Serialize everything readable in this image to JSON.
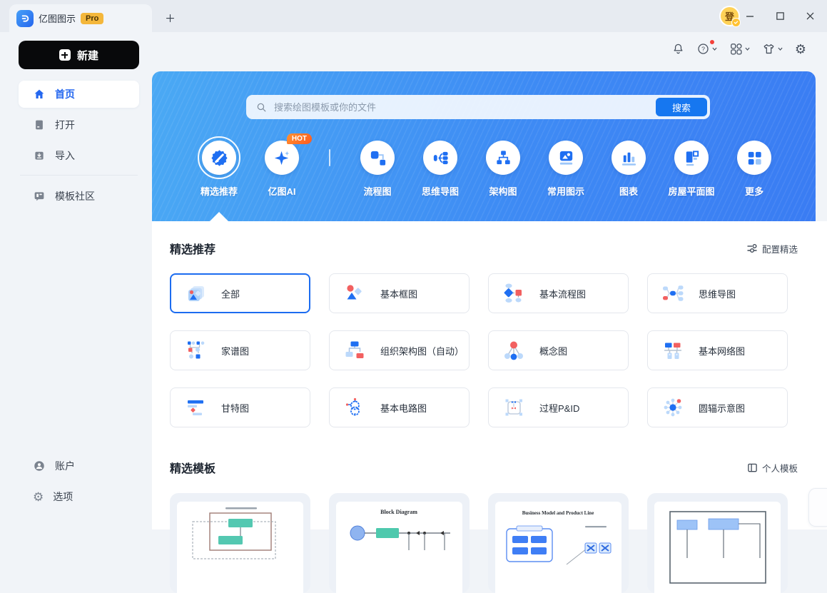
{
  "titlebar": {
    "app_name": "亿图图示",
    "pro_badge": "Pro",
    "avatar_text": "登"
  },
  "icons": {
    "gear": "⚙",
    "question": "?"
  },
  "sidebar": {
    "new_button": "新建",
    "items": [
      {
        "label": "首页",
        "icon": "home",
        "active": true
      },
      {
        "label": "打开",
        "icon": "open-document"
      },
      {
        "label": "导入",
        "icon": "import"
      },
      {
        "label": "模板社区",
        "icon": "template-community"
      }
    ],
    "footer": [
      {
        "label": "账户",
        "icon": "account"
      },
      {
        "label": "选项",
        "icon": "options-gear"
      }
    ]
  },
  "banner": {
    "search_placeholder": "搜索绘图模板或你的文件",
    "search_button": "搜索",
    "hot_badge": "HOT",
    "categories": [
      {
        "label": "精选推荐",
        "selected": true
      },
      {
        "label": "亿图AI",
        "hot": true
      },
      {
        "label": "流程图"
      },
      {
        "label": "思维导图"
      },
      {
        "label": "架构图"
      },
      {
        "label": "常用图示"
      },
      {
        "label": "图表"
      },
      {
        "label": "房屋平面图"
      },
      {
        "label": "更多"
      }
    ]
  },
  "featured": {
    "title": "精选推荐",
    "action": "配置精选",
    "cards": [
      {
        "label": "全部",
        "selected": true
      },
      {
        "label": "基本框图"
      },
      {
        "label": "基本流程图"
      },
      {
        "label": "思维导图"
      },
      {
        "label": "家谱图"
      },
      {
        "label": "组织架构图（自动）"
      },
      {
        "label": "概念图"
      },
      {
        "label": "基本网络图"
      },
      {
        "label": "甘特图"
      },
      {
        "label": "基本电路图"
      },
      {
        "label": "过程P&ID"
      },
      {
        "label": "圆辐示意图"
      }
    ]
  },
  "templates": {
    "title": "精选模板",
    "action": "个人模板",
    "previews": [
      {
        "title": ""
      },
      {
        "title": "Block Diagram"
      },
      {
        "title": "Business Model and Product Line"
      },
      {
        "title": ""
      }
    ]
  },
  "colors": {
    "accent": "#1f6ff2",
    "light_blue": "#9cc6f9",
    "red": "#f05f5f",
    "banner_from": "#4aa9f4",
    "banner_to": "#3a7cf3",
    "hot_from": "#ff9232",
    "hot_to": "#ff5a20",
    "pro_bg": "#f4b73b",
    "avatar_bg": "#ffd257"
  }
}
